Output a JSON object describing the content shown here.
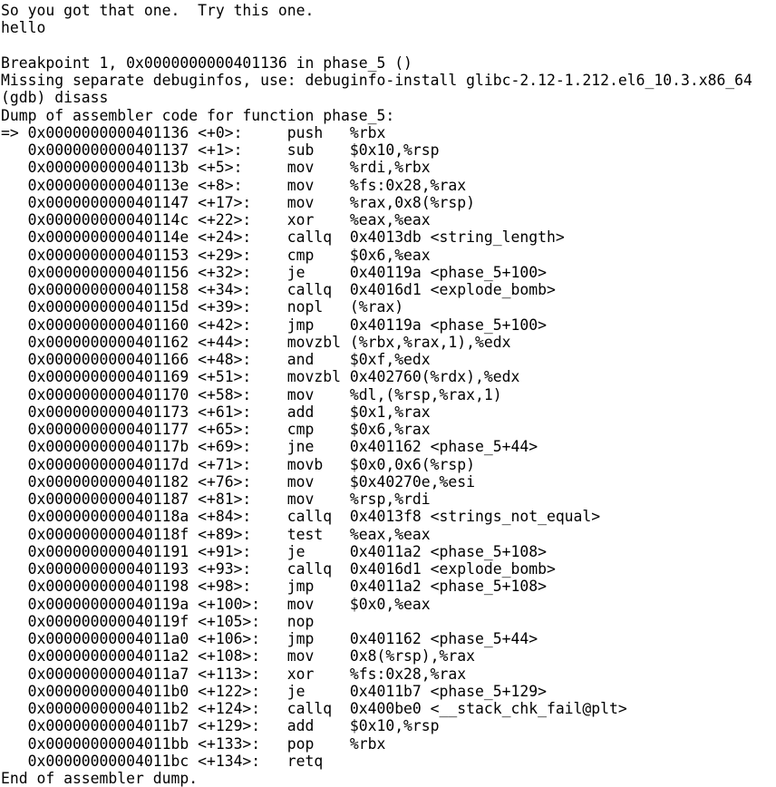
{
  "terminal": {
    "background_color": "#ffffff",
    "foreground_color": "#000000",
    "program": "gdb",
    "prompt": "(gdb)",
    "command_entered": "disass",
    "function": "phase_5"
  },
  "session": {
    "program_output": [
      "So you got that one.  Try this one.",
      "hello"
    ],
    "breakpoint_line": "Breakpoint 1, 0x0000000000401136 in phase_5 ()",
    "missing_debuginfo_line": "Missing separate debuginfos, use: debuginfo-install glibc-2.12-1.212.el6_10.3.x86_64",
    "prompt_line": "(gdb) disass",
    "dump_header": "Dump of assembler code for function phase_5:",
    "dump_footer": "End of assembler dump."
  },
  "disassembly": {
    "current_instruction_marker": "=>",
    "lines": [
      "=> 0x0000000000401136 <+0>:\tpush   %rbx",
      "   0x0000000000401137 <+1>:\tsub    $0x10,%rsp",
      "   0x000000000040113b <+5>:\tmov    %rdi,%rbx",
      "   0x000000000040113e <+8>:\tmov    %fs:0x28,%rax",
      "   0x0000000000401147 <+17>:\tmov    %rax,0x8(%rsp)",
      "   0x000000000040114c <+22>:\txor    %eax,%eax",
      "   0x000000000040114e <+24>:\tcallq  0x4013db <string_length>",
      "   0x0000000000401153 <+29>:\tcmp    $0x6,%eax",
      "   0x0000000000401156 <+32>:\tje     0x40119a <phase_5+100>",
      "   0x0000000000401158 <+34>:\tcallq  0x4016d1 <explode_bomb>",
      "   0x000000000040115d <+39>:\tnopl   (%rax)",
      "   0x0000000000401160 <+42>:\tjmp    0x40119a <phase_5+100>",
      "   0x0000000000401162 <+44>:\tmovzbl (%rbx,%rax,1),%edx",
      "   0x0000000000401166 <+48>:\tand    $0xf,%edx",
      "   0x0000000000401169 <+51>:\tmovzbl 0x402760(%rdx),%edx",
      "   0x0000000000401170 <+58>:\tmov    %dl,(%rsp,%rax,1)",
      "   0x0000000000401173 <+61>:\tadd    $0x1,%rax",
      "   0x0000000000401177 <+65>:\tcmp    $0x6,%rax",
      "   0x000000000040117b <+69>:\tjne    0x401162 <phase_5+44>",
      "   0x000000000040117d <+71>:\tmovb   $0x0,0x6(%rsp)",
      "   0x0000000000401182 <+76>:\tmov    $0x40270e,%esi",
      "   0x0000000000401187 <+81>:\tmov    %rsp,%rdi",
      "   0x000000000040118a <+84>:\tcallq  0x4013f8 <strings_not_equal>",
      "   0x000000000040118f <+89>:\ttest   %eax,%eax",
      "   0x0000000000401191 <+91>:\tje     0x4011a2 <phase_5+108>",
      "   0x0000000000401193 <+93>:\tcallq  0x4016d1 <explode_bomb>",
      "   0x0000000000401198 <+98>:\tjmp    0x4011a2 <phase_5+108>",
      "   0x000000000040119a <+100>:\tmov    $0x0,%eax",
      "   0x000000000040119f <+105>:\tnop",
      "   0x00000000004011a0 <+106>:\tjmp    0x401162 <phase_5+44>",
      "   0x00000000004011a2 <+108>:\tmov    0x8(%rsp),%rax",
      "   0x00000000004011a7 <+113>:\txor    %fs:0x28,%rax",
      "   0x00000000004011b0 <+122>:\tje     0x4011b7 <phase_5+129>",
      "   0x00000000004011b2 <+124>:\tcallq  0x400be0 <__stack_chk_fail@plt>",
      "   0x00000000004011b7 <+129>:\tadd    $0x10,%rsp",
      "   0x00000000004011bb <+133>:\tpop    %rbx",
      "   0x00000000004011bc <+134>:\tretq   "
    ]
  },
  "screen_lines": [
    "So you got that one.  Try this one.",
    "hello",
    "",
    "Breakpoint 1, 0x0000000000401136 in phase_5 ()",
    "Missing separate debuginfos, use: debuginfo-install glibc-2.12-1.212.el6_10.3.x86_64",
    "(gdb) disass",
    "Dump of assembler code for function phase_5:",
    "=> 0x0000000000401136 <+0>:\tpush   %rbx",
    "   0x0000000000401137 <+1>:\tsub    $0x10,%rsp",
    "   0x000000000040113b <+5>:\tmov    %rdi,%rbx",
    "   0x000000000040113e <+8>:\tmov    %fs:0x28,%rax",
    "   0x0000000000401147 <+17>:\tmov    %rax,0x8(%rsp)",
    "   0x000000000040114c <+22>:\txor    %eax,%eax",
    "   0x000000000040114e <+24>:\tcallq  0x4013db <string_length>",
    "   0x0000000000401153 <+29>:\tcmp    $0x6,%eax",
    "   0x0000000000401156 <+32>:\tje     0x40119a <phase_5+100>",
    "   0x0000000000401158 <+34>:\tcallq  0x4016d1 <explode_bomb>",
    "   0x000000000040115d <+39>:\tnopl   (%rax)",
    "   0x0000000000401160 <+42>:\tjmp    0x40119a <phase_5+100>",
    "   0x0000000000401162 <+44>:\tmovzbl (%rbx,%rax,1),%edx",
    "   0x0000000000401166 <+48>:\tand    $0xf,%edx",
    "   0x0000000000401169 <+51>:\tmovzbl 0x402760(%rdx),%edx",
    "   0x0000000000401170 <+58>:\tmov    %dl,(%rsp,%rax,1)",
    "   0x0000000000401173 <+61>:\tadd    $0x1,%rax",
    "   0x0000000000401177 <+65>:\tcmp    $0x6,%rax",
    "   0x000000000040117b <+69>:\tjne    0x401162 <phase_5+44>",
    "   0x000000000040117d <+71>:\tmovb   $0x0,0x6(%rsp)",
    "   0x0000000000401182 <+76>:\tmov    $0x40270e,%esi",
    "   0x0000000000401187 <+81>:\tmov    %rsp,%rdi",
    "   0x000000000040118a <+84>:\tcallq  0x4013f8 <strings_not_equal>",
    "   0x000000000040118f <+89>:\ttest   %eax,%eax",
    "   0x0000000000401191 <+91>:\tje     0x4011a2 <phase_5+108>",
    "   0x0000000000401193 <+93>:\tcallq  0x4016d1 <explode_bomb>",
    "   0x0000000000401198 <+98>:\tjmp    0x4011a2 <phase_5+108>",
    "   0x000000000040119a <+100>:\tmov    $0x0,%eax",
    "   0x000000000040119f <+105>:\tnop",
    "   0x00000000004011a0 <+106>:\tjmp    0x401162 <phase_5+44>",
    "   0x00000000004011a2 <+108>:\tmov    0x8(%rsp),%rax",
    "   0x00000000004011a7 <+113>:\txor    %fs:0x28,%rax",
    "   0x00000000004011b0 <+122>:\tje     0x4011b7 <phase_5+129>",
    "   0x00000000004011b2 <+124>:\tcallq  0x400be0 <__stack_chk_fail@plt>",
    "   0x00000000004011b7 <+129>:\tadd    $0x10,%rsp",
    "   0x00000000004011bb <+133>:\tpop    %rbx",
    "   0x00000000004011bc <+134>:\tretq   ",
    "End of assembler dump."
  ]
}
